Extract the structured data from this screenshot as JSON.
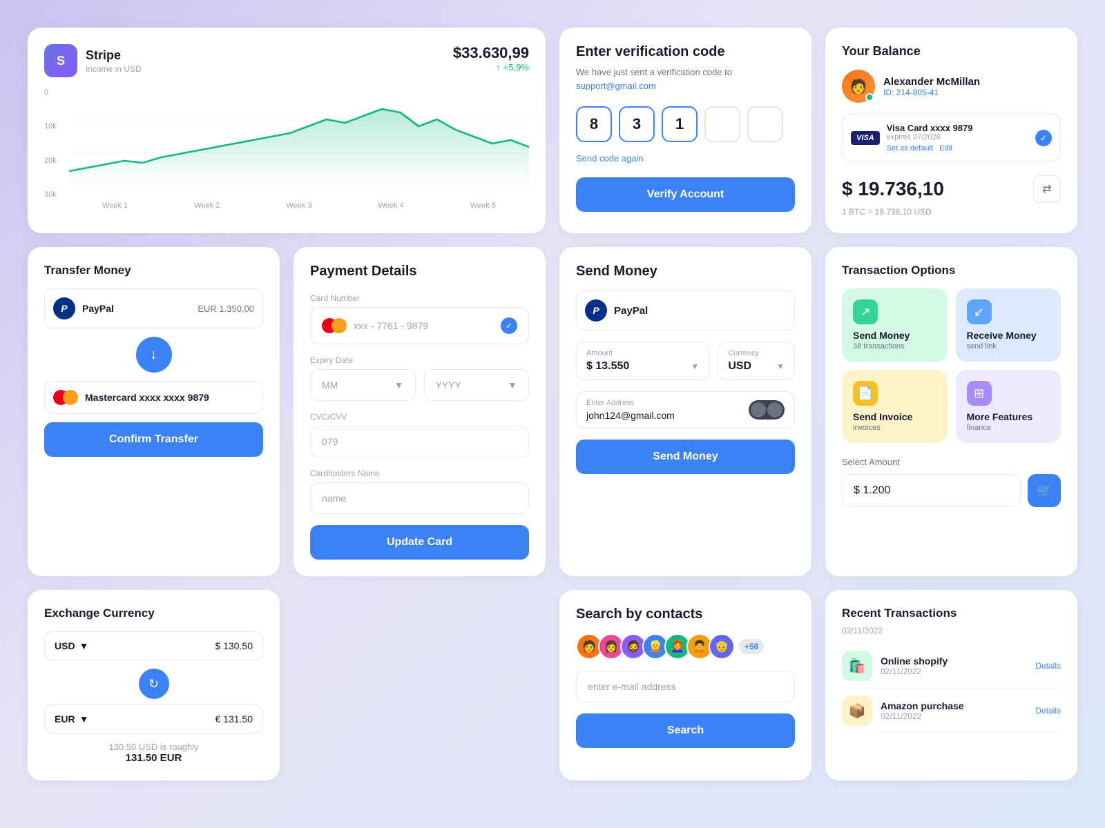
{
  "stripe": {
    "logo_letter": "S",
    "title": "Stripe",
    "subtitle": "Income in USD",
    "amount": "$33.630,99",
    "change": "+5,9%",
    "y_labels": [
      "30k",
      "20k",
      "10k",
      "0"
    ],
    "x_labels": [
      "Week 1",
      "Week 2",
      "Week 3",
      "Week 4",
      "Week 5"
    ]
  },
  "verify": {
    "title": "Enter verification code",
    "desc": "We have just sent a verification code to",
    "email": "support@gmail.com",
    "code_values": [
      "8",
      "3",
      "1",
      "",
      ""
    ],
    "send_again": "Send code again",
    "button_label": "Verify Account"
  },
  "balance": {
    "title": "Your Balance",
    "user_name": "Alexander McMillan",
    "user_id": "ID: 214-805-41",
    "avatar_emoji": "🧑",
    "card_type": "VISA",
    "card_name": "Visa Card xxxx 9879",
    "card_expires": "expires 07/2026",
    "set_default": "Set as default",
    "edit": "Edit",
    "amount": "$ 19.736,10",
    "btc_rate": "1 BTC = 19.736,10 USD"
  },
  "transfer": {
    "title": "Transfer Money",
    "provider": "PayPal",
    "amount": "EUR 1.350,00",
    "card_label": "Mastercard xxxx xxxx 9879",
    "button_label": "Confirm Transfer"
  },
  "payment": {
    "title": "Payment Details",
    "card_number_label": "Card Number",
    "card_number_value": "xxx - 7761 - 9879",
    "expiry_label": "Expiry Date",
    "expiry_mm": "MM",
    "expiry_yyyy": "YYYY",
    "cvc_label": "CVC/CVV",
    "cvc_placeholder": "079",
    "cardholder_label": "Cardholders Name",
    "cardholder_placeholder": "name",
    "button_label": "Update Card"
  },
  "send_money": {
    "title": "Send Money",
    "provider": "PayPal",
    "amount_label": "Amount",
    "amount_value": "$ 13.550",
    "currency_label": "Currency",
    "currency_value": "USD",
    "address_label": "Enter Address",
    "address_value": "john124@gmail.com",
    "button_label": "Send Money"
  },
  "options": {
    "title": "Transaction Options",
    "tiles": [
      {
        "id": "send-money",
        "label": "Send Money",
        "sub": "38 transactions",
        "color": "green",
        "icon": "↗"
      },
      {
        "id": "receive-money",
        "label": "Receive Money",
        "sub": "send link",
        "color": "blue",
        "icon": "↙"
      },
      {
        "id": "send-invoice",
        "label": "Send Invoice",
        "sub": "invoices",
        "color": "yellow",
        "icon": "📄"
      },
      {
        "id": "more-features",
        "label": "More Features",
        "sub": "finance",
        "color": "purple",
        "icon": "⊞"
      }
    ],
    "select_amount_label": "Select Amount",
    "amount_value": "$ 1.200",
    "cart_icon": "🛒"
  },
  "exchange": {
    "title": "Exchange Currency",
    "from_currency": "USD",
    "from_amount": "$ 130.50",
    "to_currency": "EUR",
    "to_amount": "€ 131.50",
    "note": "130.50 USD is roughly",
    "result": "131.50 EUR"
  },
  "search_contacts": {
    "title": "Search by contacts",
    "contact_avatars": [
      "🧑",
      "👩",
      "🧔",
      "👱",
      "👩‍🦰",
      "🧑‍🦱",
      "👴"
    ],
    "more_count": "+58",
    "email_placeholder": "enter e-mail address",
    "button_label": "Search"
  },
  "recent": {
    "title": "Recent Transactions",
    "date": "02/11/2022",
    "transactions": [
      {
        "id": "shopify",
        "name": "Online shopify",
        "date": "02/11/2022",
        "icon": "🛍️",
        "color": "shopify",
        "action": "Details"
      },
      {
        "id": "amazon",
        "name": "Amazon purchase",
        "date": "02/11/2022",
        "icon": "📦",
        "color": "amazon",
        "action": "Details"
      }
    ]
  }
}
